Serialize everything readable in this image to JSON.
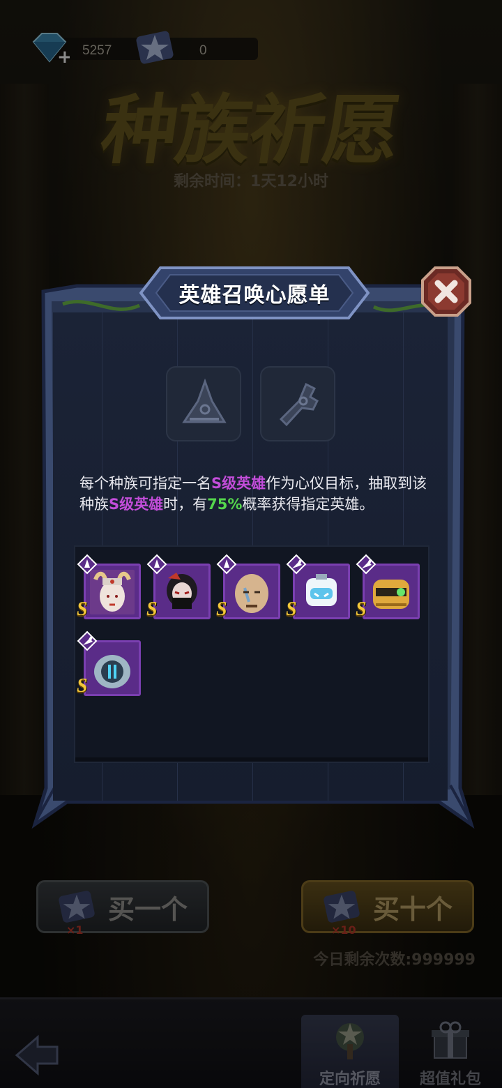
{
  "currency": {
    "gems": "5257",
    "tickets": "0"
  },
  "event": {
    "title": "种族祈愿",
    "timer": "剩余时间：1天12小时"
  },
  "modal": {
    "title": "英雄召唤心愿单",
    "slots": [
      {
        "icon": "mage-hat-icon"
      },
      {
        "icon": "mech-wrench-icon"
      }
    ],
    "desc": {
      "p1": "每个种族可指定一名",
      "h1": "S级英雄",
      "p2": "作为心仪目标，抽取到该种族",
      "h2": "S级英雄",
      "p3": "时，有",
      "h3": "75%",
      "p4": "概率获得指定英雄。"
    },
    "heroes": [
      {
        "race": "mage",
        "grade": "S",
        "face_color": "#d8c8bf",
        "name_icon": "horned-priestess-portrait"
      },
      {
        "race": "mage",
        "grade": "S",
        "face_color": "#3a2a2e",
        "name_icon": "masked-ninja-portrait"
      },
      {
        "race": "mage",
        "grade": "S",
        "face_color": "#c9a57e",
        "name_icon": "bald-warrior-portrait"
      },
      {
        "race": "mech",
        "grade": "S",
        "face_color": "#bfe3f2",
        "name_icon": "white-robot-portrait"
      },
      {
        "race": "mech",
        "grade": "S",
        "face_color": "#d7a13a",
        "name_icon": "gold-robot-portrait"
      },
      {
        "race": "mech",
        "grade": "S",
        "face_color": "#2f4e63",
        "name_icon": "armored-robot-portrait"
      }
    ]
  },
  "buy": {
    "one_label": "买一个",
    "one_mult": "×1",
    "ten_label": "买十个",
    "ten_mult": "×10",
    "remain": "今日剩余次数:999999"
  },
  "nav": {
    "wish_label": "定向祈愿",
    "gift_label": "超值礼包"
  }
}
